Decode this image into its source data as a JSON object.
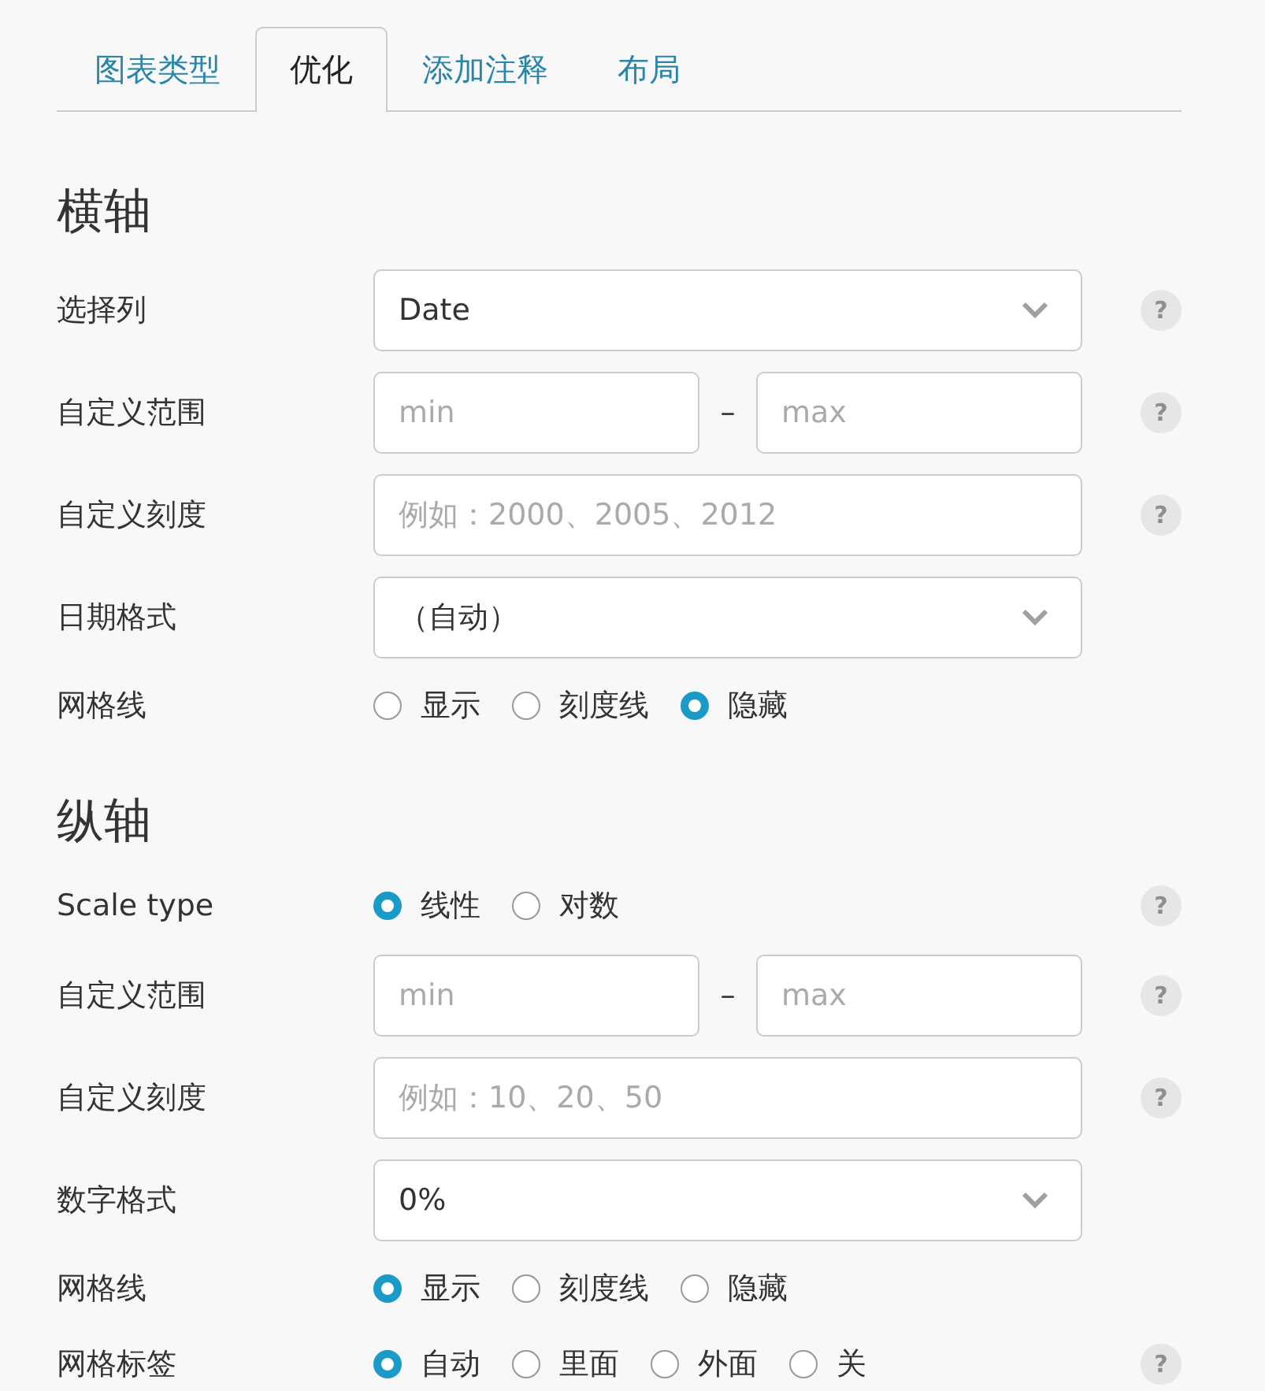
{
  "tabs": [
    {
      "label": "图表类型",
      "selected": false
    },
    {
      "label": "优化",
      "selected": true
    },
    {
      "label": "添加注释",
      "selected": false
    },
    {
      "label": "布局",
      "selected": false
    }
  ],
  "sections": [
    {
      "title": "横轴",
      "rows": [
        {
          "kind": "select",
          "label": "选择列",
          "value": "Date",
          "help": "?"
        },
        {
          "kind": "range",
          "label": "自定义范围",
          "min_placeholder": "min",
          "separator": "–",
          "max_placeholder": "max",
          "help": "?"
        },
        {
          "kind": "text",
          "label": "自定义刻度",
          "placeholder": "例如：2000、2005、2012",
          "help": "?"
        },
        {
          "kind": "select",
          "label": "日期格式",
          "value": "（自动）"
        },
        {
          "kind": "radio",
          "label": "网格线",
          "options": [
            {
              "label": "显示",
              "selected": false
            },
            {
              "label": "刻度线",
              "selected": false
            },
            {
              "label": "隐藏",
              "selected": true
            }
          ]
        }
      ]
    },
    {
      "title": "纵轴",
      "rows": [
        {
          "kind": "radio",
          "label": "Scale type",
          "options": [
            {
              "label": "线性",
              "selected": true
            },
            {
              "label": "对数",
              "selected": false
            }
          ],
          "help": "?"
        },
        {
          "kind": "range",
          "label": "自定义范围",
          "min_placeholder": "min",
          "separator": "–",
          "max_placeholder": "max",
          "help": "?"
        },
        {
          "kind": "text",
          "label": "自定义刻度",
          "placeholder": "例如：10、20、50",
          "help": "?"
        },
        {
          "kind": "select",
          "label": "数字格式",
          "value": "0%"
        },
        {
          "kind": "radio",
          "label": "网格线",
          "options": [
            {
              "label": "显示",
              "selected": true
            },
            {
              "label": "刻度线",
              "selected": false
            },
            {
              "label": "隐藏",
              "selected": false
            }
          ]
        },
        {
          "kind": "radio",
          "label": "网格标签",
          "options": [
            {
              "label": "自动",
              "selected": true
            },
            {
              "label": "里面",
              "selected": false
            },
            {
              "label": "外面",
              "selected": false
            },
            {
              "label": "关",
              "selected": false
            }
          ],
          "help": "?"
        }
      ]
    }
  ]
}
